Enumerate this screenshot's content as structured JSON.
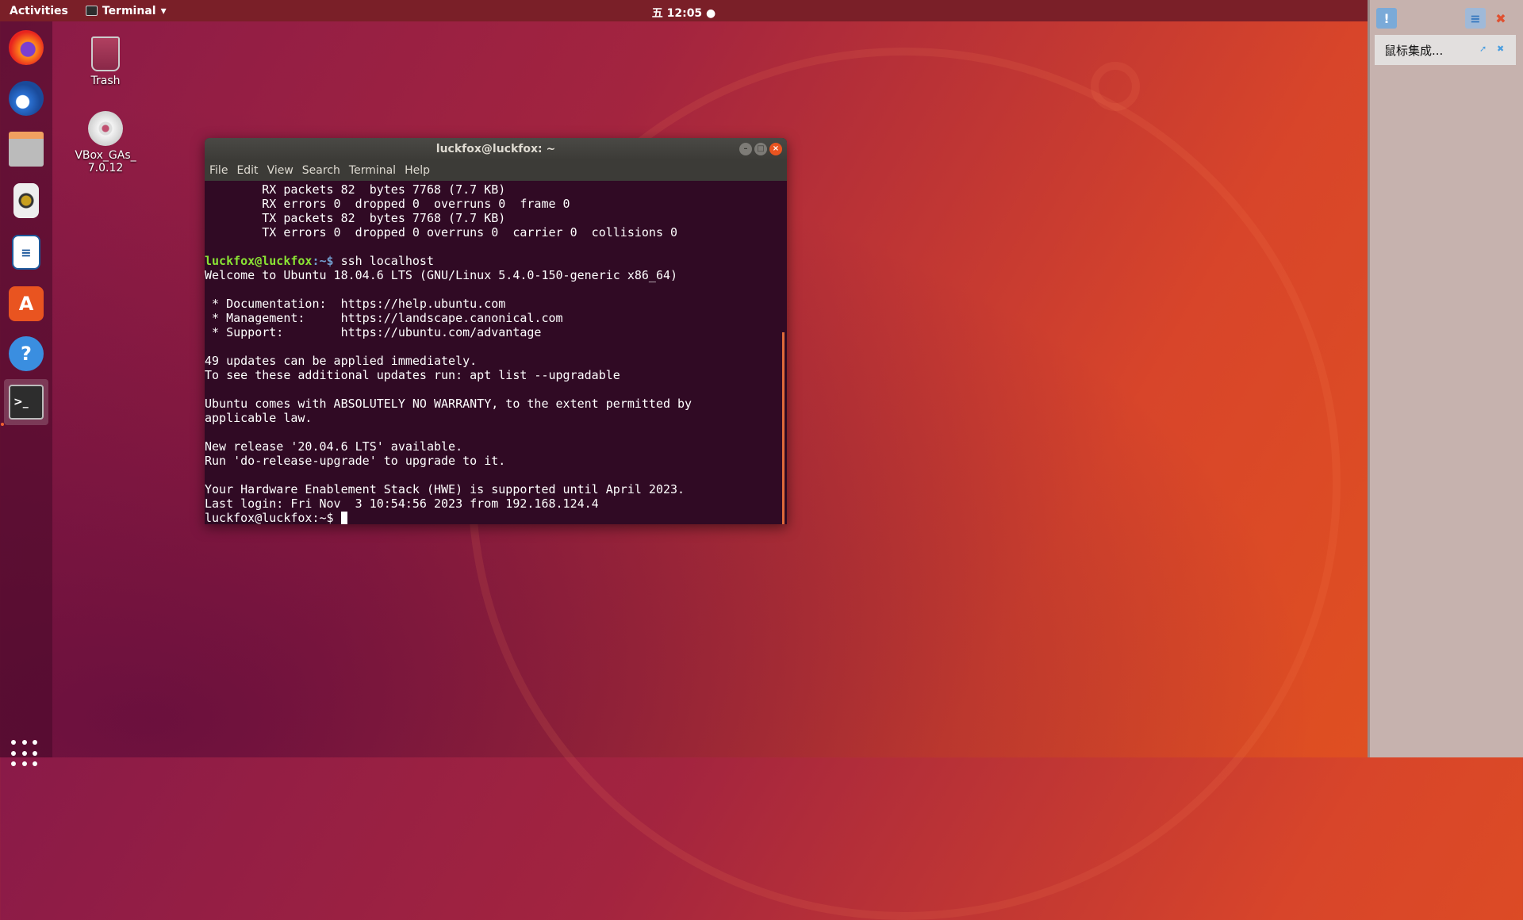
{
  "topbar": {
    "activities": "Activities",
    "app_menu": "Terminal",
    "clock": "五 12:05"
  },
  "dock": {
    "items": [
      "firefox",
      "thunderbird",
      "files",
      "rhythmbox",
      "libreoffice-writer",
      "ubuntu-software",
      "help",
      "terminal"
    ],
    "active": "terminal"
  },
  "desktop": {
    "icons": [
      {
        "label": "Trash"
      },
      {
        "label": "VBox_GAs_\n7.0.12"
      }
    ]
  },
  "terminal": {
    "title": "luckfox@luckfox: ~",
    "menu": [
      "File",
      "Edit",
      "View",
      "Search",
      "Terminal",
      "Help"
    ],
    "lines_before": [
      "        RX packets 82  bytes 7768 (7.7 KB)",
      "        RX errors 0  dropped 0  overruns 0  frame 0",
      "        TX packets 82  bytes 7768 (7.7 KB)",
      "        TX errors 0  dropped 0 overruns 0  carrier 0  collisions 0",
      ""
    ],
    "prompt_user": "luckfox@luckfox",
    "prompt_path": ":~$ ",
    "command": "ssh localhost",
    "lines_after": [
      "Welcome to Ubuntu 18.04.6 LTS (GNU/Linux 5.4.0-150-generic x86_64)",
      "",
      " * Documentation:  https://help.ubuntu.com",
      " * Management:     https://landscape.canonical.com",
      " * Support:        https://ubuntu.com/advantage",
      "",
      "49 updates can be applied immediately.",
      "To see these additional updates run: apt list --upgradable",
      "",
      "Ubuntu comes with ABSOLUTELY NO WARRANTY, to the extent permitted by",
      "applicable law.",
      "",
      "New release '20.04.6 LTS' available.",
      "Run 'do-release-upgrade' to upgrade to it.",
      "",
      "Your Hardware Enablement Stack (HWE) is supported until April 2023.",
      "Last login: Fri Nov  3 10:54:56 2023 from 192.168.124.4"
    ],
    "final_prompt": "luckfox@luckfox:~$ "
  },
  "vbox_panel": {
    "notice": "鼠标集成..."
  },
  "colors": {
    "accent": "#e95420",
    "terminal_bg": "#300a24",
    "prompt_user": "#8ae234"
  }
}
